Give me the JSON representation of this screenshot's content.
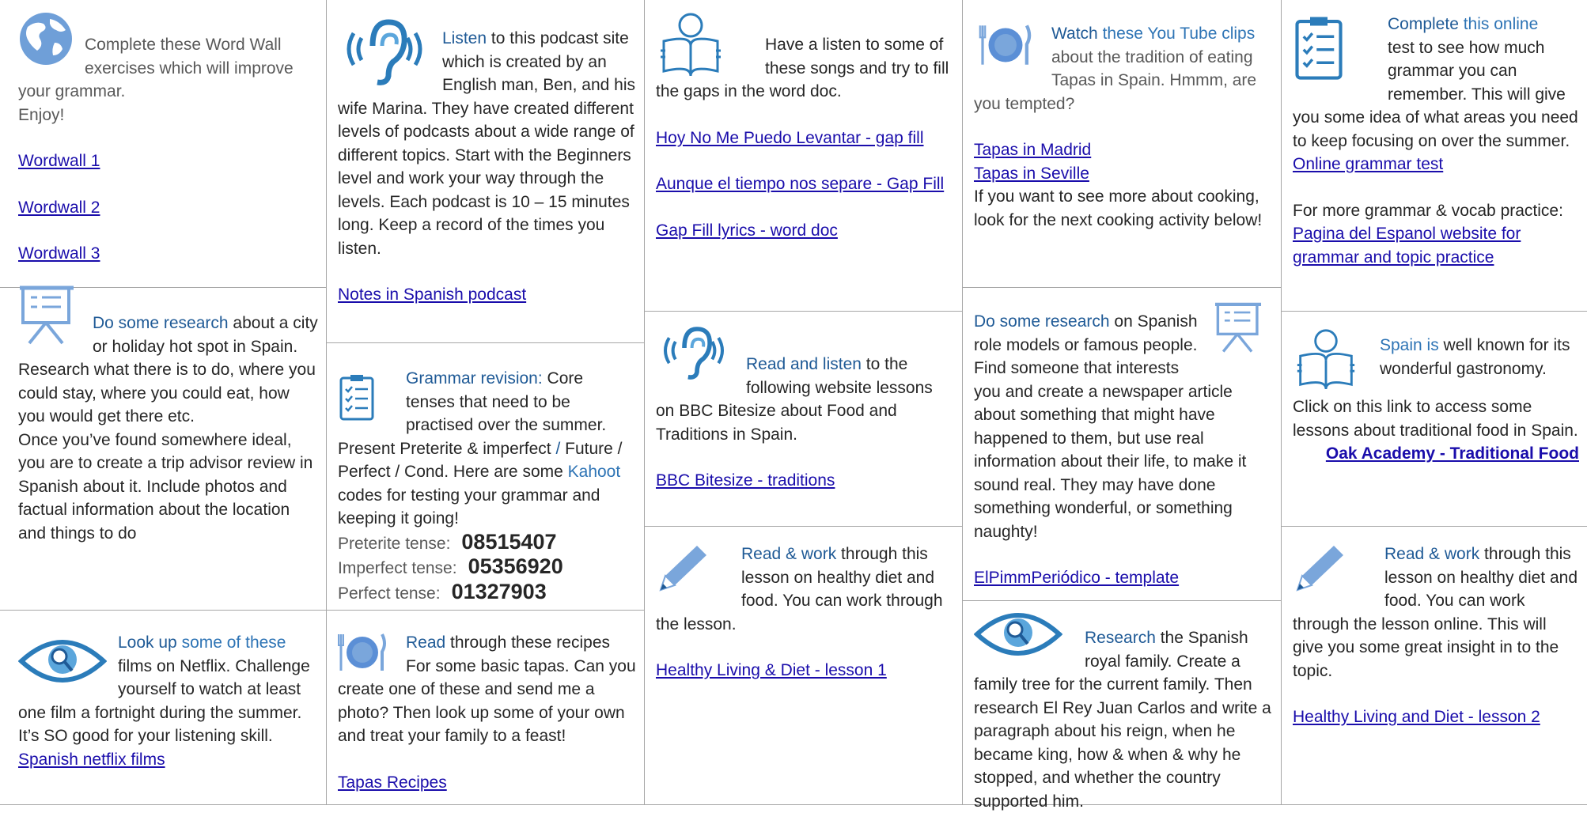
{
  "col1": {
    "wordwall": {
      "text1": "Complete these Word Wall exercises which will improve your grammar.",
      "text2": "Enjoy!",
      "links": [
        "Wordwall 1",
        "Wordwall 2",
        "Wordwall 3"
      ]
    },
    "research": {
      "heading": "Do some research",
      "text1": " about a city or holiday hot spot in Spain. Research what there is to do, where you could stay, where you could eat, how you would get there etc.",
      "text2": "Once you’ve found somewhere ideal, you are to create a trip advisor review in Spanish about it.   Include photos and factual information about the location and things to do"
    },
    "films": {
      "heading": "Look up",
      "heading_rest": " some of these",
      "text": "films on Netflix.  Challenge yourself to watch at least one film a fortnight during the summer.  It’s SO good for your listening skill.",
      "link": "Spanish netflix films"
    }
  },
  "col2": {
    "podcast": {
      "heading": "Listen",
      "text": " to this podcast site which is created by an English man, Ben, and his wife Marina.  They have created different levels of podcasts about a wide range of different topics.  Start with the Beginners level and work your way through the levels.  Each podcast is 10 – 15 minutes long.  Keep a record of the times you listen.",
      "link": "Notes in Spanish podcast"
    },
    "grammar": {
      "heading": "Grammar revision:",
      "text1": "   Core tenses that need to be practised over the summer.  Present Preterite & imperfect ",
      "slash": "/",
      "text2": " Future / Perfect / Cond.     Here are some ",
      "kahoot": "Kahoot",
      "text3": " codes for testing your grammar and keeping it going!",
      "codes": [
        {
          "label": "Preterite tense:",
          "code": "08515407"
        },
        {
          "label": "Imperfect tense:",
          "code": "05356920"
        },
        {
          "label": "Perfect tense:",
          "code": "01327903"
        }
      ]
    },
    "recipes": {
      "heading": "Read",
      "text": " through these recipes For some basic tapas.  Can you create one of these and send me a photo?   Then look up some of your own and treat your family to a feast!",
      "link": "Tapas Recipes"
    }
  },
  "col3": {
    "songs": {
      "text": "Have a listen to some of these songs and try to fill the gaps in the word doc.",
      "links": [
        "Hoy No Me Puedo Levantar - gap fill",
        "Aunque el tiempo nos separe - Gap Fill",
        "Gap Fill lyrics - word doc"
      ]
    },
    "bbc": {
      "heading": "Read and listen",
      "text": " to the following website lessons on BBC Bitesize about Food and Traditions in Spain.",
      "link": "BBC Bitesize - traditions"
    },
    "healthy1": {
      "heading": "Read & work",
      "text": " through this lesson on healthy diet and food.  You can work through the lesson.",
      "link": "Healthy Living & Diet - lesson 1"
    }
  },
  "col4": {
    "tapas": {
      "heading": "Watch",
      "heading_rest": " these You Tube clips",
      "text": "about the tradition of eating Tapas in Spain. Hmmm, are you tempted?",
      "links": [
        "Tapas in Madrid",
        "Tapas in Seville"
      ],
      "text2": "If you want to see more about cooking, look for the next cooking activity below!"
    },
    "rolemodels": {
      "heading": "Do some research",
      "text": " on Spanish role models or famous people.  Find someone that interests you and create a newspaper article about something that might have happened to them, but use real information about their life, to make it sound real.  They may have done something wonderful, or something naughty!",
      "link": "ElPimmPeriódico - template"
    },
    "royal": {
      "heading": "Research",
      "text": " the Spanish royal family. Create a family tree for the current family.  Then research El Rey Juan Carlos and write a paragraph about his reign, when he became king, how & when & why he stopped, and whether the country supported him."
    }
  },
  "col5": {
    "test": {
      "heading": "Complete",
      "heading_rest": " this online",
      "text": "test to see how much grammar you can remember.  This will give you some idea of what areas you need to keep focusing on over the summer.",
      "link": "Online grammar test",
      "text2": "For more grammar & vocab practice:",
      "link2": "Pagina del Espanol website for grammar and topic practice"
    },
    "gastronomy": {
      "heading": "Spain is",
      "heading_rest": " well known for its wonderful gastronomy.",
      "text": "Click on this link to access some lessons about traditional food in Spain.",
      "link": "Oak Academy - Traditional Food"
    },
    "healthy2": {
      "heading": "Read & work",
      "text": " through this lesson on healthy diet and food.  You can work through the lesson online.  This will give you some great insight in to the topic.",
      "link": "Healthy Living and Diet - lesson 2"
    }
  }
}
